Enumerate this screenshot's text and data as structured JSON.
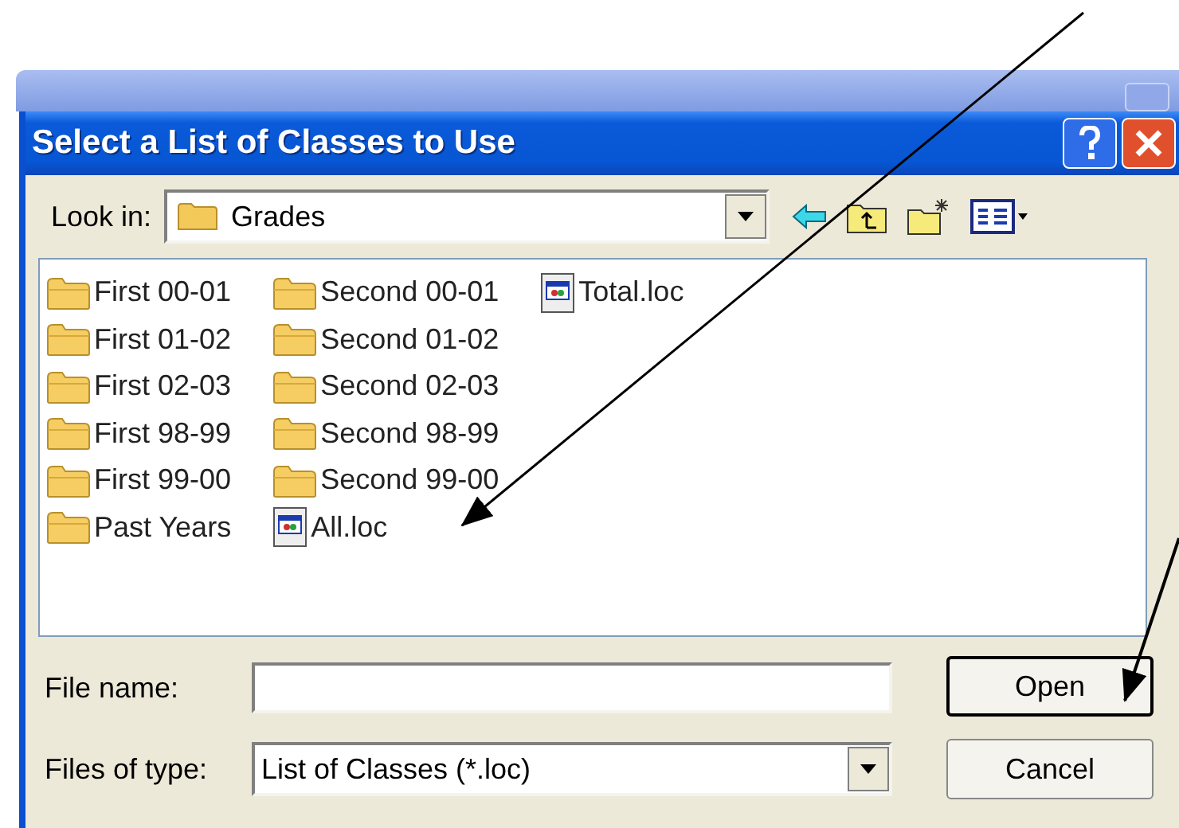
{
  "window": {
    "title": "Select a List of Classes to Use"
  },
  "look_in": {
    "label": "Look in:",
    "value": "Grades"
  },
  "file_list": {
    "items": [
      {
        "name": "First 00-01",
        "kind": "folder"
      },
      {
        "name": "First 01-02",
        "kind": "folder"
      },
      {
        "name": "First 02-03",
        "kind": "folder"
      },
      {
        "name": "First 98-99",
        "kind": "folder"
      },
      {
        "name": "First 99-00",
        "kind": "folder"
      },
      {
        "name": "Past Years",
        "kind": "folder"
      },
      {
        "name": "Second 00-01",
        "kind": "folder"
      },
      {
        "name": "Second 01-02",
        "kind": "folder"
      },
      {
        "name": "Second 02-03",
        "kind": "folder"
      },
      {
        "name": "Second 98-99",
        "kind": "folder"
      },
      {
        "name": "Second 99-00",
        "kind": "folder"
      },
      {
        "name": "All.loc",
        "kind": "file"
      },
      {
        "name": "Total.loc",
        "kind": "file"
      }
    ]
  },
  "file_name": {
    "label": "File name:"
  },
  "files_of_type": {
    "label": "Files of type:",
    "value": "List of Classes (*.loc)"
  },
  "buttons": [
    {
      "label": "Open",
      "default": true
    },
    {
      "label": "Cancel",
      "default": false
    }
  ]
}
